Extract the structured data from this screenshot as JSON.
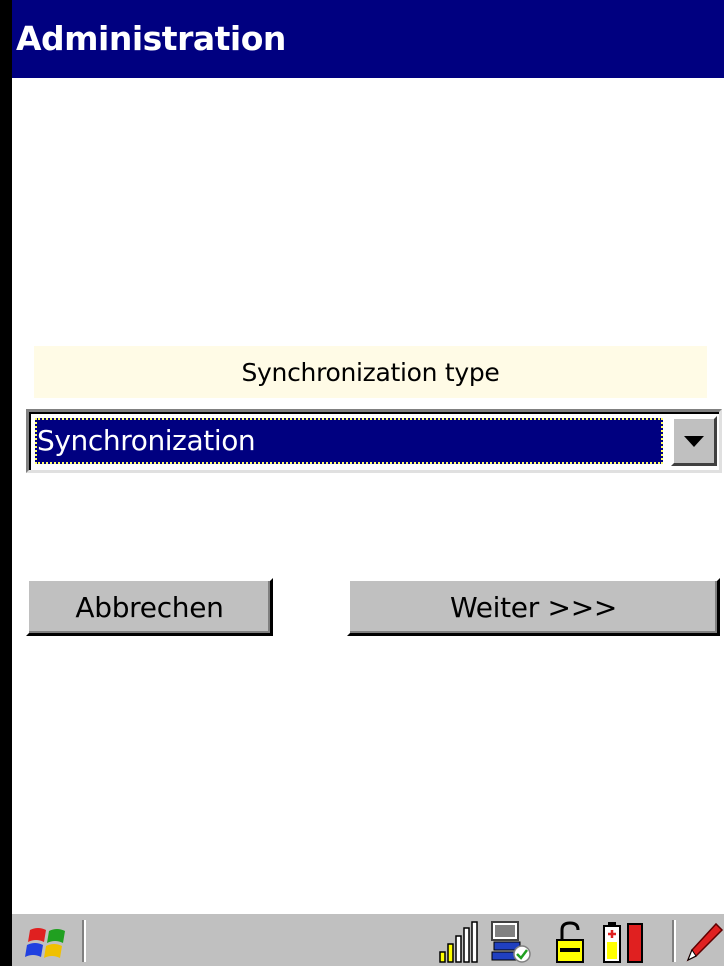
{
  "window": {
    "title": "Administration"
  },
  "form": {
    "label": "Synchronization type",
    "combo": {
      "selected": "Synchronization"
    },
    "buttons": {
      "cancel": "Abbrechen",
      "next": "Weiter >>>"
    }
  },
  "colors": {
    "title_bar": "#000080",
    "label_background": "#fffbe6",
    "selection": "#000080",
    "taskbar": "#c0c0c0"
  },
  "taskbar": {
    "icons": [
      "windows-start-icon",
      "signal-strength-icon",
      "network-sync-icon",
      "lock-icon",
      "battery-icon",
      "pen-input-icon"
    ]
  }
}
